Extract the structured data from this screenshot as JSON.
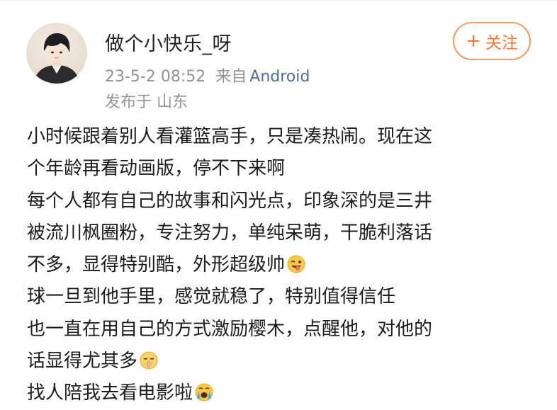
{
  "user": {
    "name": "做个小快乐_呀",
    "avatar_icon": "anime-boy-avatar-icon"
  },
  "meta": {
    "time": "23-5-2 08:52",
    "from_label": "来自",
    "source": "Android",
    "location": "发布于 山东"
  },
  "follow_button": {
    "plus": "+",
    "label": "关注"
  },
  "content": {
    "lines": [
      "小时候跟着别人看灌篮高手，只是凑热闹。现在这",
      "个年龄再看动画版，停不下来啊",
      "每个人都有自己的故事和闪光点，印象深的是三井",
      "被流川枫圈粉，专注努力，单纯呆萌，干脆利落话",
      "不多，显得特别酷，外形超级帅",
      "球一旦到他手里，感觉就稳了，特别值得信任",
      "也一直在用自己的方式激励樱木，点醒他，对他的",
      "话显得尤其多",
      "找人陪我去看电影啦"
    ],
    "emojis": {
      "line5": "tongue-wink-emoji-icon",
      "line8": "shh-face-emoji-icon",
      "line9": "crying-face-emoji-icon"
    }
  },
  "colors": {
    "accent_orange": "#ee7a3a",
    "link_blue": "#4e6f9a",
    "meta_gray": "#939393",
    "text": "#1c1c1c"
  }
}
